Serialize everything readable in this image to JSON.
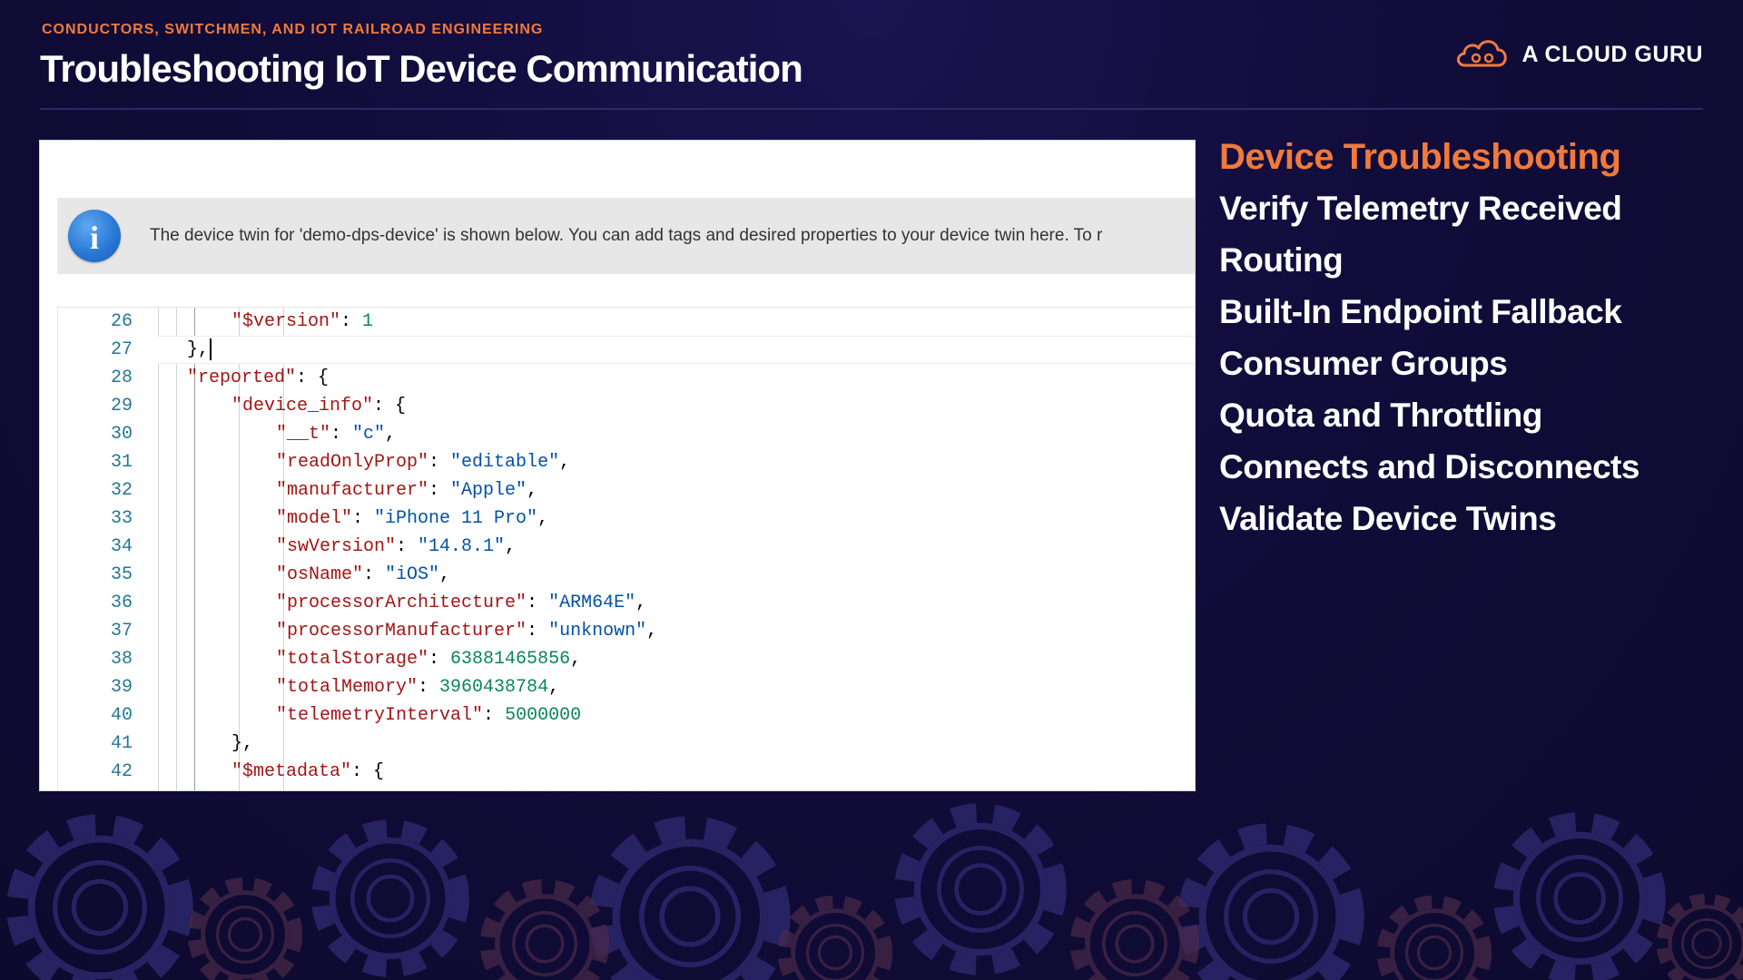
{
  "header": {
    "kicker": "CONDUCTORS, SWITCHMEN, AND IOT RAILROAD ENGINEERING",
    "title": "Troubleshooting IoT Device Communication",
    "brand": "A CLOUD GURU",
    "brand_icon": "cloud-logo-icon"
  },
  "info": {
    "icon": "info-icon",
    "text": "The device twin for 'demo-dps-device' is shown below. You can add tags and desired properties to your device twin here. To r"
  },
  "code_lines": [
    {
      "num": "26",
      "tokens": [
        {
          "t": "\"$version\"",
          "c": "k"
        },
        {
          "t": ": ",
          "c": "p"
        },
        {
          "t": "1",
          "c": "n"
        }
      ]
    },
    {
      "num": "27",
      "tokens": [
        {
          "t": "},",
          "c": "p"
        }
      ]
    },
    {
      "num": "28",
      "tokens": [
        {
          "t": "\"reported\"",
          "c": "k"
        },
        {
          "t": ": {",
          "c": "p"
        }
      ]
    },
    {
      "num": "29",
      "tokens": [
        {
          "t": "\"device_info\"",
          "c": "k"
        },
        {
          "t": ": {",
          "c": "p"
        }
      ]
    },
    {
      "num": "30",
      "tokens": [
        {
          "t": "\"__t\"",
          "c": "k"
        },
        {
          "t": ": ",
          "c": "p"
        },
        {
          "t": "\"c\"",
          "c": "s"
        },
        {
          "t": ",",
          "c": "p"
        }
      ]
    },
    {
      "num": "31",
      "tokens": [
        {
          "t": "\"readOnlyProp\"",
          "c": "k"
        },
        {
          "t": ": ",
          "c": "p"
        },
        {
          "t": "\"editable\"",
          "c": "s"
        },
        {
          "t": ",",
          "c": "p"
        }
      ]
    },
    {
      "num": "32",
      "tokens": [
        {
          "t": "\"manufacturer\"",
          "c": "k"
        },
        {
          "t": ": ",
          "c": "p"
        },
        {
          "t": "\"Apple\"",
          "c": "s"
        },
        {
          "t": ",",
          "c": "p"
        }
      ]
    },
    {
      "num": "33",
      "tokens": [
        {
          "t": "\"model\"",
          "c": "k"
        },
        {
          "t": ": ",
          "c": "p"
        },
        {
          "t": "\"iPhone 11 Pro\"",
          "c": "s"
        },
        {
          "t": ",",
          "c": "p"
        }
      ]
    },
    {
      "num": "34",
      "tokens": [
        {
          "t": "\"swVersion\"",
          "c": "k"
        },
        {
          "t": ": ",
          "c": "p"
        },
        {
          "t": "\"14.8.1\"",
          "c": "s"
        },
        {
          "t": ",",
          "c": "p"
        }
      ]
    },
    {
      "num": "35",
      "tokens": [
        {
          "t": "\"osName\"",
          "c": "k"
        },
        {
          "t": ": ",
          "c": "p"
        },
        {
          "t": "\"iOS\"",
          "c": "s"
        },
        {
          "t": ",",
          "c": "p"
        }
      ]
    },
    {
      "num": "36",
      "tokens": [
        {
          "t": "\"processorArchitecture\"",
          "c": "k"
        },
        {
          "t": ": ",
          "c": "p"
        },
        {
          "t": "\"ARM64E\"",
          "c": "s"
        },
        {
          "t": ",",
          "c": "p"
        }
      ]
    },
    {
      "num": "37",
      "tokens": [
        {
          "t": "\"processorManufacturer\"",
          "c": "k"
        },
        {
          "t": ": ",
          "c": "p"
        },
        {
          "t": "\"unknown\"",
          "c": "s"
        },
        {
          "t": ",",
          "c": "p"
        }
      ]
    },
    {
      "num": "38",
      "tokens": [
        {
          "t": "\"totalStorage\"",
          "c": "k"
        },
        {
          "t": ": ",
          "c": "p"
        },
        {
          "t": "63881465856",
          "c": "n"
        },
        {
          "t": ",",
          "c": "p"
        }
      ]
    },
    {
      "num": "39",
      "tokens": [
        {
          "t": "\"totalMemory\"",
          "c": "k"
        },
        {
          "t": ": ",
          "c": "p"
        },
        {
          "t": "3960438784",
          "c": "n"
        },
        {
          "t": ",",
          "c": "p"
        }
      ]
    },
    {
      "num": "40",
      "tokens": [
        {
          "t": "\"telemetryInterval\"",
          "c": "k"
        },
        {
          "t": ": ",
          "c": "p"
        },
        {
          "t": "5000000",
          "c": "n"
        }
      ]
    },
    {
      "num": "41",
      "tokens": [
        {
          "t": "},",
          "c": "p"
        }
      ]
    },
    {
      "num": "42",
      "tokens": [
        {
          "t": "\"$metadata\"",
          "c": "k"
        },
        {
          "t": ": {",
          "c": "p"
        }
      ]
    }
  ],
  "topics": [
    "Device Troubleshooting",
    "Verify Telemetry Received",
    "Routing",
    "Built-In Endpoint Fallback",
    "Consumer Groups",
    "Quota and Throttling",
    "Connects and Disconnects",
    "Validate Device Twins"
  ],
  "colors": {
    "accent": "#f07a3c",
    "background": "#110c3a",
    "json_key": "#a31515",
    "json_string": "#0451a5",
    "json_number": "#098658",
    "line_number": "#237893"
  }
}
